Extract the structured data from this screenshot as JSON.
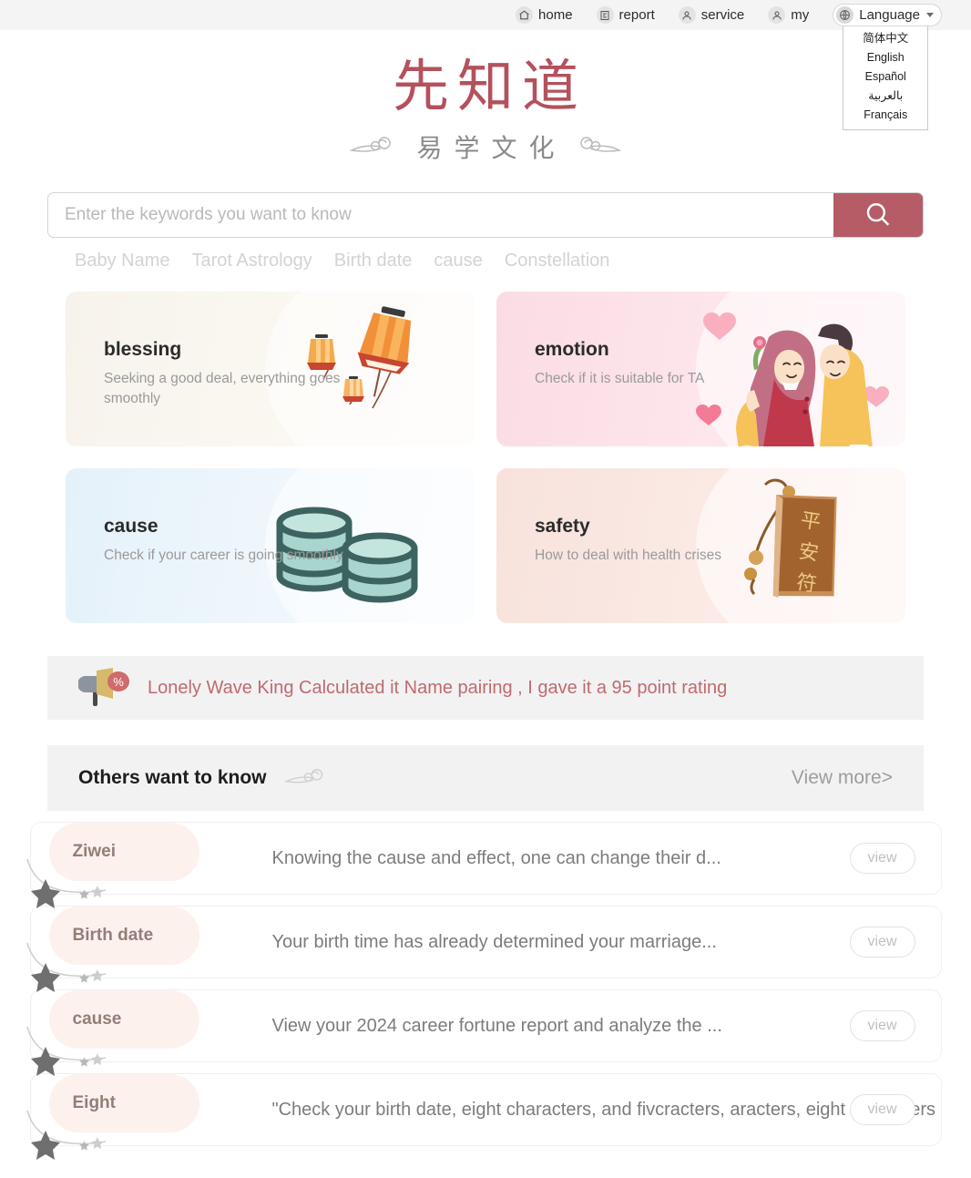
{
  "topnav": {
    "items": [
      {
        "label": "home",
        "icon": "home-icon"
      },
      {
        "label": "report",
        "icon": "report-icon"
      },
      {
        "label": "service",
        "icon": "service-icon"
      },
      {
        "label": "my",
        "icon": "user-icon"
      }
    ],
    "language": {
      "label": "Language",
      "icon": "globe-icon",
      "expanded": true,
      "options": [
        "简体中文",
        "English",
        "Español",
        "بالعربية",
        "Français"
      ]
    }
  },
  "logo": {
    "title": "先知道",
    "subtitle": "易学文化",
    "color": "#b4515c"
  },
  "search": {
    "placeholder": "Enter the keywords you want to know",
    "value": "",
    "button_icon": "search-icon",
    "button_color": "#b55c66"
  },
  "tags": [
    "Baby Name",
    "Tarot Astrology",
    "Birth date",
    "cause",
    "Constellation"
  ],
  "cards": [
    {
      "title": "blessing",
      "desc": "Seeking a good deal, everything goes smoothly",
      "art": "lantern-illustration",
      "theme": "card-blessing"
    },
    {
      "title": "emotion",
      "desc": "Check if it is suitable for TA",
      "art": "couple-illustration",
      "theme": "card-emotion"
    },
    {
      "title": "cause",
      "desc": "Check if your career is going smoothly",
      "art": "coins-illustration",
      "theme": "card-cause"
    },
    {
      "title": "safety",
      "desc": "How to deal with health crises",
      "art": "amulet-illustration",
      "theme": "card-safety"
    }
  ],
  "announcement": {
    "icon": "megaphone-icon",
    "text": "Lonely Wave King Calculated it   Name pairing ,   I gave it a 95 point rating",
    "color": "#c16a6f"
  },
  "others_section": {
    "title": "Others want to know",
    "ornament": "cloud-icon",
    "view_more": "View more",
    "view_more_chevron": ">"
  },
  "list": {
    "button_label": "view",
    "rows": [
      {
        "tag": "Ziwei",
        "text": "Knowing the cause and effect, one can change their d..."
      },
      {
        "tag": "Birth date",
        "text": "Your birth time has already determined your marriage..."
      },
      {
        "tag": "cause",
        "text": "View your 2024 career fortune report and analyze the ..."
      },
      {
        "tag": "Eight",
        "text": "\"Check your birth date, eight characters, and fivcracters, aracters, eight characters"
      }
    ]
  }
}
